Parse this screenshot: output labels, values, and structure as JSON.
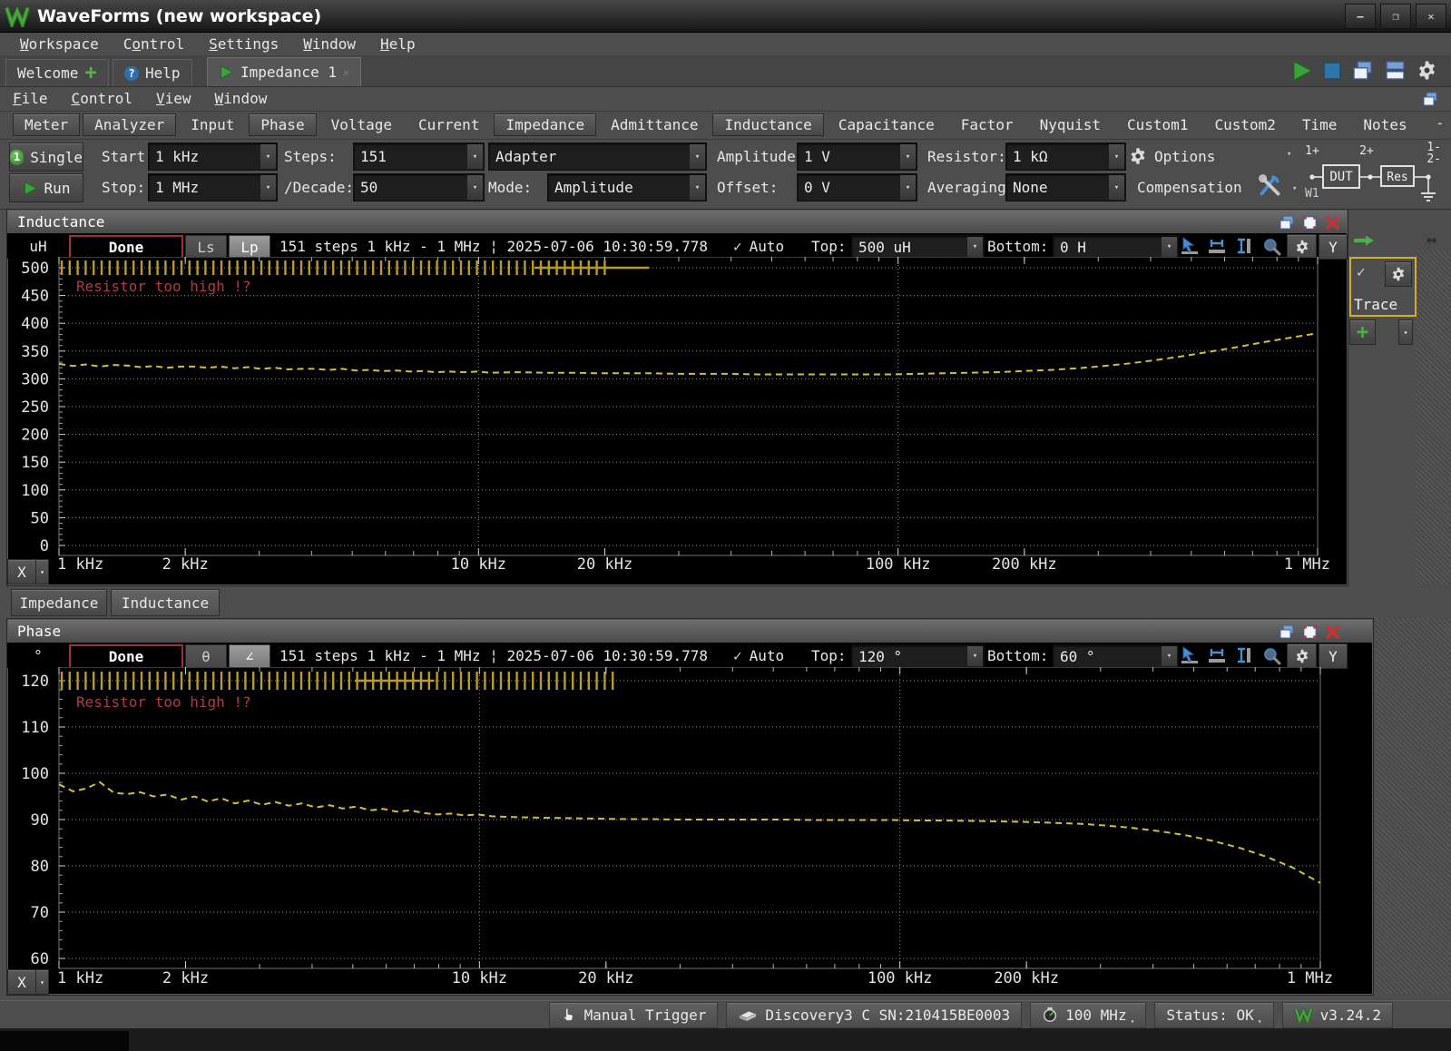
{
  "window": {
    "title": "WaveForms (new workspace)"
  },
  "menubar": {
    "items": [
      {
        "label": "Workspace",
        "accel": 0
      },
      {
        "label": "Control",
        "accel": 1
      },
      {
        "label": "Settings",
        "accel": 0
      },
      {
        "label": "Window",
        "accel": 0
      },
      {
        "label": "Help",
        "accel": 0
      }
    ]
  },
  "workspace_tabs": {
    "welcome": "Welcome",
    "help": "Help",
    "impedance": "Impedance 1"
  },
  "inner_menubar": {
    "items": [
      {
        "label": "File",
        "accel": 0
      },
      {
        "label": "Control",
        "accel": 0
      },
      {
        "label": "View",
        "accel": 0
      },
      {
        "label": "Window",
        "accel": 0
      }
    ]
  },
  "instrument_tabs": {
    "items": [
      "Meter",
      "Analyzer",
      "Input",
      "Phase",
      "Voltage",
      "Current",
      "Impedance",
      "Admittance",
      "Inductance",
      "Capacitance",
      "Factor",
      "Nyquist",
      "Custom1",
      "Custom2",
      "Time",
      "Notes"
    ],
    "raised": [
      "Meter",
      "Analyzer",
      "Phase",
      "Impedance",
      "Inductance"
    ],
    "collapse": "-"
  },
  "toolbar": {
    "single": "Single",
    "run": "Run",
    "start_label": "Start:",
    "start": "1 kHz",
    "stop_label": "Stop:",
    "stop": "1 MHz",
    "steps_label": "Steps:",
    "steps": "151",
    "decade_label": "/Decade:",
    "decade": "50",
    "adapter": "Adapter",
    "mode_label": "Mode:",
    "mode": "Amplitude",
    "amplitude_label": "Amplitude:",
    "amplitude": "1 V",
    "offset_label": "Offset:",
    "offset": "0 V",
    "resistor_label": "Resistor:",
    "resistor": "1 kΩ",
    "averaging_label": "Averaging:",
    "averaging": "None",
    "options": "Options",
    "compensation": "Compensation",
    "circuit": {
      "w1": "W1",
      "p1": "1+",
      "p2": "2+",
      "m1": "1-",
      "m2": "2-",
      "dut": "DUT",
      "res": "Res"
    }
  },
  "inductance_window": {
    "title": "Inductance",
    "unit": "uH",
    "done": "Done",
    "mode_a": "Ls",
    "mode_b": "Lp",
    "status": "151 steps 1 kHz - 1 MHz ¦ 2025-07-06 10:30:59.778",
    "auto_label": "Auto",
    "top_label": "Top:",
    "top": "500 uH",
    "bottom_label": "Bottom:",
    "bottom": "0 H",
    "y_btn": "Y",
    "x_btn": "X"
  },
  "subwindow_tabs": {
    "items": [
      "Impedance",
      "Inductance"
    ]
  },
  "phase_window": {
    "title": "Phase",
    "unit": "°",
    "done": "Done",
    "mode_a": "θ",
    "mode_b": "∠",
    "status": "151 steps 1 kHz - 1 MHz ¦ 2025-07-06 10:30:59.778",
    "auto_label": "Auto",
    "top_label": "Top:",
    "top": "120 °",
    "bottom_label": "Bottom:",
    "bottom": "60 °",
    "y_btn": "Y",
    "x_btn": "X"
  },
  "trace_panel": {
    "label": "Trace"
  },
  "statusbar": {
    "manual_trigger": "Manual Trigger",
    "device": "Discovery3 C SN:210415BE0003",
    "frequency": "100 MHz",
    "status": "Status: OK",
    "version": "v3.24.2"
  },
  "chart_data": [
    {
      "type": "line",
      "title": "Inductance",
      "unit": "uH",
      "x_scale": "log",
      "x_range_hz": [
        1000,
        1000000
      ],
      "ylim": [
        0,
        500
      ],
      "y_ticks": [
        0,
        50,
        100,
        150,
        200,
        250,
        300,
        350,
        400,
        450,
        500
      ],
      "x_ticks": [
        [
          1000,
          "1 kHz"
        ],
        [
          2000,
          "2 kHz"
        ],
        [
          10000,
          "10 kHz"
        ],
        [
          20000,
          "20 kHz"
        ],
        [
          100000,
          "100 kHz"
        ],
        [
          200000,
          "200 kHz"
        ],
        [
          1000000,
          "1 MHz"
        ]
      ],
      "grid_x_hz": [
        10000,
        100000
      ],
      "warning": "Resistor too high !?",
      "overload_ticks_hz": [
        1000,
        20500
      ],
      "overload_bar_hz": [
        13600,
        25500
      ],
      "trace_color": "#d2bf3a",
      "series": [
        {
          "name": "Lp",
          "points": [
            [
              1000,
              327
            ],
            [
              1080,
              323
            ],
            [
              1160,
              326
            ],
            [
              1250,
              322
            ],
            [
              1350,
              325
            ],
            [
              1450,
              324
            ],
            [
              1560,
              321
            ],
            [
              1680,
              323
            ],
            [
              1810,
              320
            ],
            [
              1950,
              322
            ],
            [
              2100,
              322
            ],
            [
              2260,
              320
            ],
            [
              2430,
              322
            ],
            [
              2620,
              319
            ],
            [
              2820,
              321
            ],
            [
              3040,
              318
            ],
            [
              3270,
              320
            ],
            [
              3520,
              317
            ],
            [
              3790,
              318
            ],
            [
              4080,
              318
            ],
            [
              4400,
              316
            ],
            [
              4730,
              318
            ],
            [
              5100,
              315
            ],
            [
              5490,
              316
            ],
            [
              5910,
              314
            ],
            [
              6360,
              315
            ],
            [
              6850,
              313
            ],
            [
              7380,
              314
            ],
            [
              7940,
              312
            ],
            [
              8550,
              313
            ],
            [
              9210,
              312
            ],
            [
              9910,
              313
            ],
            [
              10700,
              311
            ],
            [
              12400,
              312
            ],
            [
              14300,
              311
            ],
            [
              16600,
              311
            ],
            [
              19200,
              310
            ],
            [
              22200,
              310
            ],
            [
              25700,
              310
            ],
            [
              29800,
              309
            ],
            [
              34500,
              309
            ],
            [
              39900,
              309
            ],
            [
              46200,
              308
            ],
            [
              53500,
              308
            ],
            [
              61900,
              308
            ],
            [
              71700,
              308
            ],
            [
              83000,
              308
            ],
            [
              96100,
              308
            ],
            [
              111000,
              309
            ],
            [
              129000,
              310
            ],
            [
              149000,
              311
            ],
            [
              172000,
              312
            ],
            [
              199000,
              314
            ],
            [
              231000,
              316
            ],
            [
              267000,
              319
            ],
            [
              309000,
              323
            ],
            [
              358000,
              328
            ],
            [
              414000,
              334
            ],
            [
              479000,
              341
            ],
            [
              555000,
              349
            ],
            [
              642000,
              357
            ],
            [
              743000,
              366
            ],
            [
              860000,
              374
            ],
            [
              1000000,
              382
            ]
          ]
        }
      ]
    },
    {
      "type": "line",
      "title": "Phase",
      "unit": "°",
      "x_scale": "log",
      "x_range_hz": [
        1000,
        1000000
      ],
      "ylim": [
        60,
        120
      ],
      "y_ticks": [
        60,
        70,
        80,
        90,
        100,
        110,
        120
      ],
      "x_ticks": [
        [
          1000,
          "1 kHz"
        ],
        [
          2000,
          "2 kHz"
        ],
        [
          10000,
          "10 kHz"
        ],
        [
          20000,
          "20 kHz"
        ],
        [
          100000,
          "100 kHz"
        ],
        [
          200000,
          "200 kHz"
        ],
        [
          1000000,
          "1 MHz"
        ]
      ],
      "grid_x_hz": [
        10000,
        100000
      ],
      "warning": "Resistor too high !?",
      "overload_ticks_hz": [
        1000,
        21000
      ],
      "overload_bar_hz": [
        5050,
        7800
      ],
      "trace_color": "#d2bf3a",
      "series": [
        {
          "name": "∠",
          "points": [
            [
              1000,
              97.6
            ],
            [
              1080,
              96.1
            ],
            [
              1160,
              96.7
            ],
            [
              1250,
              98.1
            ],
            [
              1350,
              95.8
            ],
            [
              1450,
              95.5
            ],
            [
              1560,
              95.9
            ],
            [
              1680,
              95.0
            ],
            [
              1810,
              95.4
            ],
            [
              1950,
              94.3
            ],
            [
              2100,
              95.0
            ],
            [
              2260,
              93.9
            ],
            [
              2430,
              94.6
            ],
            [
              2620,
              93.5
            ],
            [
              2820,
              94.1
            ],
            [
              3040,
              93.2
            ],
            [
              3270,
              93.8
            ],
            [
              3520,
              93.0
            ],
            [
              3790,
              93.5
            ],
            [
              4080,
              92.6
            ],
            [
              4400,
              93.1
            ],
            [
              4730,
              92.4
            ],
            [
              5100,
              92.8
            ],
            [
              5490,
              92.0
            ],
            [
              5910,
              92.3
            ],
            [
              6360,
              91.7
            ],
            [
              6850,
              92.0
            ],
            [
              7380,
              91.4
            ],
            [
              7940,
              91.1
            ],
            [
              8550,
              91.3
            ],
            [
              9210,
              90.9
            ],
            [
              9910,
              91.1
            ],
            [
              10700,
              90.7
            ],
            [
              12400,
              90.5
            ],
            [
              14300,
              90.4
            ],
            [
              16600,
              90.3
            ],
            [
              19200,
              90.2
            ],
            [
              22200,
              90.1
            ],
            [
              25700,
              90.1
            ],
            [
              29800,
              90.0
            ],
            [
              34500,
              90.0
            ],
            [
              39900,
              90.0
            ],
            [
              46200,
              90.0
            ],
            [
              53500,
              90.0
            ],
            [
              61900,
              89.9
            ],
            [
              71700,
              89.9
            ],
            [
              83000,
              89.9
            ],
            [
              96100,
              89.9
            ],
            [
              111000,
              89.8
            ],
            [
              129000,
              89.8
            ],
            [
              149000,
              89.7
            ],
            [
              172000,
              89.6
            ],
            [
              199000,
              89.5
            ],
            [
              231000,
              89.3
            ],
            [
              267000,
              89.1
            ],
            [
              309000,
              88.7
            ],
            [
              358000,
              88.2
            ],
            [
              414000,
              87.5
            ],
            [
              479000,
              86.6
            ],
            [
              555000,
              85.4
            ],
            [
              642000,
              83.9
            ],
            [
              743000,
              82.0
            ],
            [
              860000,
              79.6
            ],
            [
              1000000,
              76.3
            ]
          ]
        }
      ]
    }
  ]
}
